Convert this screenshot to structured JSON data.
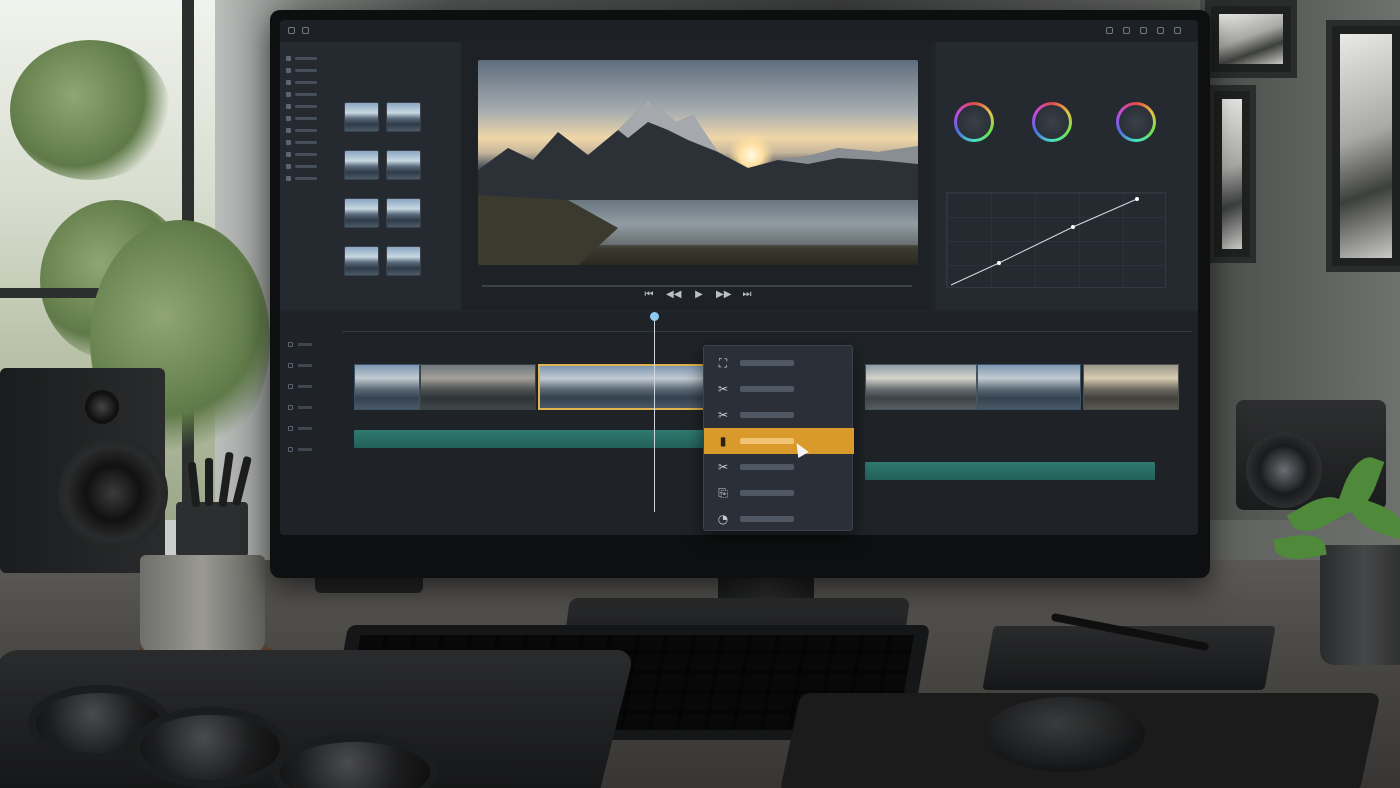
{
  "scene": {
    "description_hidden": false,
    "accent_color": "#d99a2b",
    "playhead_color": "#8ecbf2"
  },
  "app": {
    "topbar_icons": [
      "close-icon",
      "settings-icon",
      "grid-icon",
      "panel-icon",
      "expand-icon"
    ],
    "media_browser": {
      "thumbnail_count": 8
    },
    "viewer": {
      "transport": [
        "skip-back-icon",
        "step-back-icon",
        "play-icon",
        "step-forward-icon",
        "skip-forward-icon"
      ],
      "transport_glyphs": [
        "⏮",
        "◀◀",
        "▶",
        "▶▶",
        "⏭"
      ]
    },
    "color": {
      "wheels": 3
    },
    "timeline": {
      "tracks": 6
    },
    "context_menu": {
      "items": [
        {
          "icon": "crop-icon",
          "glyph": "⛶"
        },
        {
          "icon": "scissors-icon",
          "glyph": "✂"
        },
        {
          "icon": "scissors-icon",
          "glyph": "✂"
        },
        {
          "icon": "clipboard-icon",
          "glyph": "▮"
        },
        {
          "icon": "scissors-icon",
          "glyph": "✂"
        },
        {
          "icon": "paste-icon",
          "glyph": "⎘"
        },
        {
          "icon": "tag-icon",
          "glyph": "◔"
        }
      ],
      "highlighted_index": 3
    }
  }
}
